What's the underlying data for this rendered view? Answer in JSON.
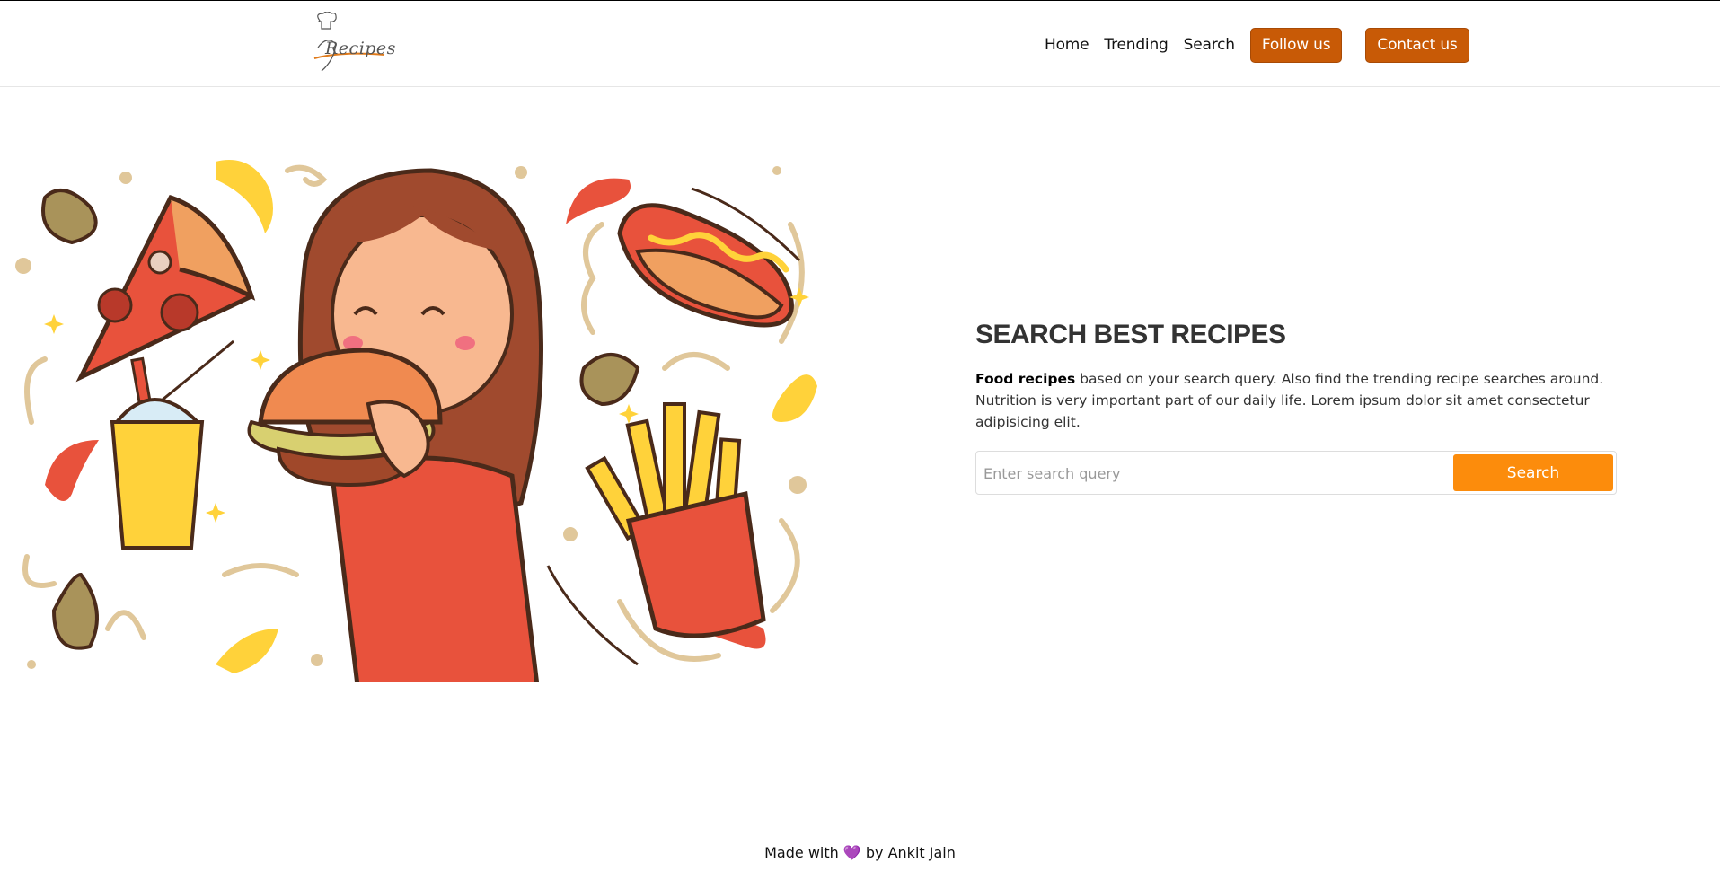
{
  "header": {
    "logo_text": "Recipes",
    "nav": {
      "home": "Home",
      "trending": "Trending",
      "search": "Search",
      "follow": "Follow us",
      "contact": "Contact us"
    }
  },
  "main": {
    "title": "SEARCH BEST RECIPES",
    "desc_bold": "Food recipes",
    "desc_rest": " based on your search query. Also find the trending recipe searches around. Nutrition is very important part of our daily life. Lorem ipsum dolor sit amet consectetur adipisicing elit.",
    "search": {
      "placeholder": "Enter search query",
      "value": "",
      "button": "Search"
    }
  },
  "footer": {
    "prefix": "Made with",
    "heart": "💜",
    "suffix": "by Ankit Jain"
  },
  "colors": {
    "nav_button": "#c85a06",
    "search_button": "#fc8c0c"
  }
}
